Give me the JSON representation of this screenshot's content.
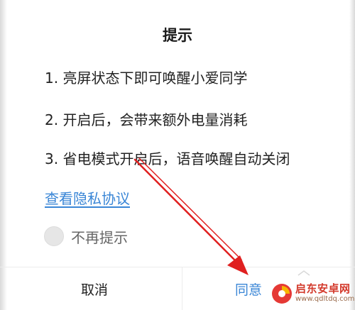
{
  "dialog": {
    "title": "提示",
    "tips": [
      "1. 亮屏状态下即可唤醒小爱同学",
      "2. 开启后，会带来额外电量消耗",
      "3. 省电模式开启后，语音唤醒自动关闭"
    ],
    "privacy_link": "查看隐私协议",
    "checkbox": {
      "label": "不再提示",
      "checked": false
    },
    "buttons": {
      "cancel": "取消",
      "agree": "同意"
    }
  },
  "annotation": {
    "arrow_color": "#e02020"
  },
  "watermark": {
    "name": "启东安卓网",
    "url": "www.qdltdq.com",
    "logo_colors": [
      "#e53935",
      "#f7b500"
    ]
  }
}
